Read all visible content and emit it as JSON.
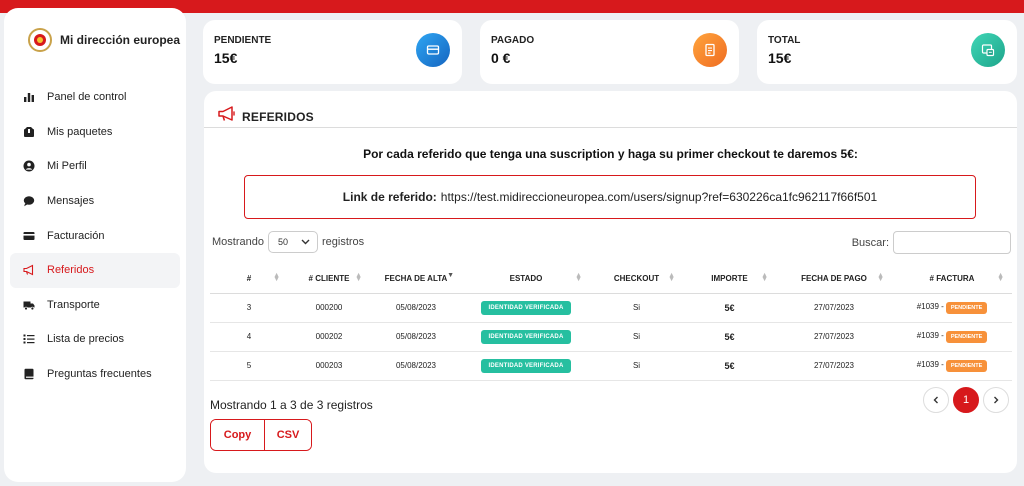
{
  "colors": {
    "brand_red": "#d7191c",
    "blue": "#1e88e5",
    "orange": "#f57c30",
    "teal": "#26bfa0"
  },
  "sidebar": {
    "brand": "Mi dirección europea",
    "items": [
      {
        "label": "Panel de control",
        "icon": "bar-chart-icon"
      },
      {
        "label": "Mis paquetes",
        "icon": "package-icon"
      },
      {
        "label": "Mi Perfil",
        "icon": "user-icon"
      },
      {
        "label": "Mensajes",
        "icon": "chat-icon"
      },
      {
        "label": "Facturación",
        "icon": "credit-card-icon"
      },
      {
        "label": "Referidos",
        "icon": "megaphone-icon",
        "active": true
      },
      {
        "label": "Transporte",
        "icon": "truck-icon"
      },
      {
        "label": "Lista de precios",
        "icon": "list-icon"
      },
      {
        "label": "Preguntas frecuentes",
        "icon": "book-icon"
      }
    ]
  },
  "stats": [
    {
      "label": "PENDIENTE",
      "value": "15€",
      "icon": "wallet-icon"
    },
    {
      "label": "PAGADO",
      "value": "0 €",
      "icon": "invoice-icon"
    },
    {
      "label": "TOTAL",
      "value": "15€",
      "icon": "receipt-icon"
    }
  ],
  "referidos": {
    "title": "REFERIDOS",
    "promo": "Por cada referido que tenga una suscription y haga su primer checkout te daremos 5€:",
    "link_label": "Link de referido:",
    "link_url": "https://test.midireccioneuropea.com/users/signup?ref=630226ca1fc962117f66f501",
    "length": {
      "prefix": "Mostrando",
      "value": "50",
      "suffix": "registros"
    },
    "search_label": "Buscar:",
    "columns": [
      "#",
      "# CLIENTE",
      "FECHA DE ALTA",
      "ESTADO",
      "CHECKOUT",
      "IMPORTE",
      "FECHA DE PAGO",
      "# FACTURA"
    ],
    "rows": [
      {
        "num": "3",
        "cliente": "000200",
        "alta": "05/08/2023",
        "estado": "IDENTIDAD VERIFICADA",
        "checkout": "Si",
        "importe": "5€",
        "pago": "27/07/2023",
        "factura": "#1039 -",
        "factura_estado": "PENDIENTE"
      },
      {
        "num": "4",
        "cliente": "000202",
        "alta": "05/08/2023",
        "estado": "IDENTIDAD VERIFICADA",
        "checkout": "Si",
        "importe": "5€",
        "pago": "27/07/2023",
        "factura": "#1039 -",
        "factura_estado": "PENDIENTE"
      },
      {
        "num": "5",
        "cliente": "000203",
        "alta": "05/08/2023",
        "estado": "IDENTIDAD VERIFICADA",
        "checkout": "Si",
        "importe": "5€",
        "pago": "27/07/2023",
        "factura": "#1039 -",
        "factura_estado": "PENDIENTE"
      }
    ],
    "info": "Mostrando 1 a 3 de 3 registros",
    "current_page": "1",
    "buttons": {
      "copy": "Copy",
      "csv": "CSV"
    }
  }
}
